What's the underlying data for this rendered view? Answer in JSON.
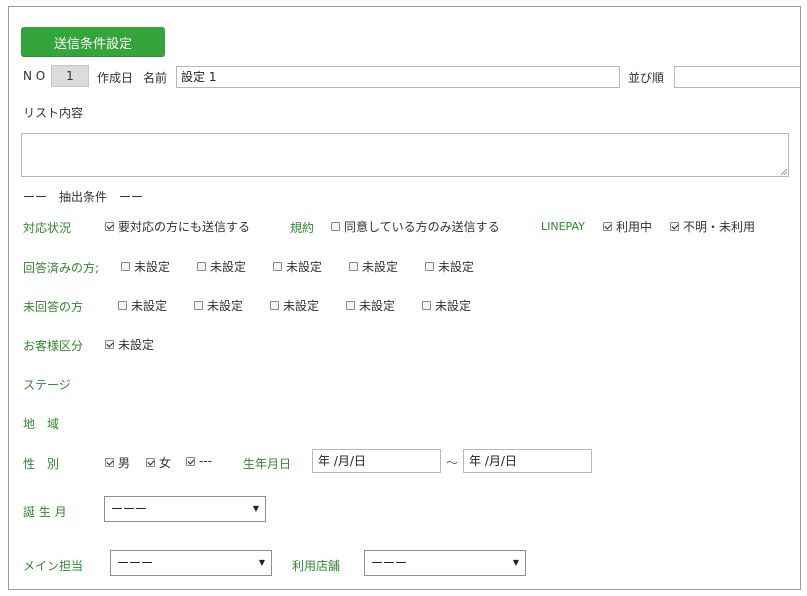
{
  "header": {
    "submit_label": "送信条件設定"
  },
  "top_row": {
    "no_label": "N O",
    "no_value": "1",
    "created_label": "作成日",
    "name_label": "名前",
    "name_value": "設定 1",
    "sort_label": "並び順",
    "sort_value": ""
  },
  "list_content": {
    "label": "リスト内容",
    "value": ""
  },
  "extraction": {
    "heading": "ーー　抽出条件　ーー"
  },
  "support": {
    "label": "対応状況",
    "option_label": "要対応の方にも送信する",
    "option_checked": true
  },
  "terms": {
    "label": "規約",
    "option_label": "同意している方のみ送信する",
    "option_checked": false
  },
  "linepay": {
    "label": "LINEPAY",
    "options": [
      {
        "label": "利用中",
        "checked": true
      },
      {
        "label": "不明・未利用",
        "checked": true
      }
    ]
  },
  "answered": {
    "label": "回答済みの方;",
    "options": [
      {
        "label": "未設定",
        "checked": false
      },
      {
        "label": "未設定",
        "checked": false
      },
      {
        "label": "未設定",
        "checked": false
      },
      {
        "label": "未設定",
        "checked": false
      },
      {
        "label": "未設定",
        "checked": false
      }
    ]
  },
  "unanswered": {
    "label": "未回答の方",
    "options": [
      {
        "label": "未設定",
        "checked": false
      },
      {
        "label": "未設定",
        "checked": false
      },
      {
        "label": "未設定",
        "checked": false
      },
      {
        "label": "未設定",
        "checked": false
      },
      {
        "label": "未設定",
        "checked": false
      }
    ]
  },
  "customer_class": {
    "label": "お客様区分",
    "option_label": "未設定",
    "option_checked": true
  },
  "stage": {
    "label": "ステージ"
  },
  "region": {
    "label": "地　域"
  },
  "gender": {
    "label": "性　別",
    "options": [
      {
        "label": "男",
        "checked": true
      },
      {
        "label": "女",
        "checked": true
      },
      {
        "label": "---",
        "checked": true
      }
    ]
  },
  "birthdate": {
    "label": "生年月日",
    "from_value": "年 /月/日",
    "separator": "〜",
    "to_value": "年 /月/日"
  },
  "birth_month": {
    "label": "誕 生 月",
    "selected": "ーーー"
  },
  "main_staff": {
    "label": "メイン担当",
    "selected": "ーーー"
  },
  "store": {
    "label": "利用店舗",
    "selected": "ーーー"
  },
  "colors": {
    "accent_green": "#34a53a",
    "label_green": "#2e8b2e"
  }
}
